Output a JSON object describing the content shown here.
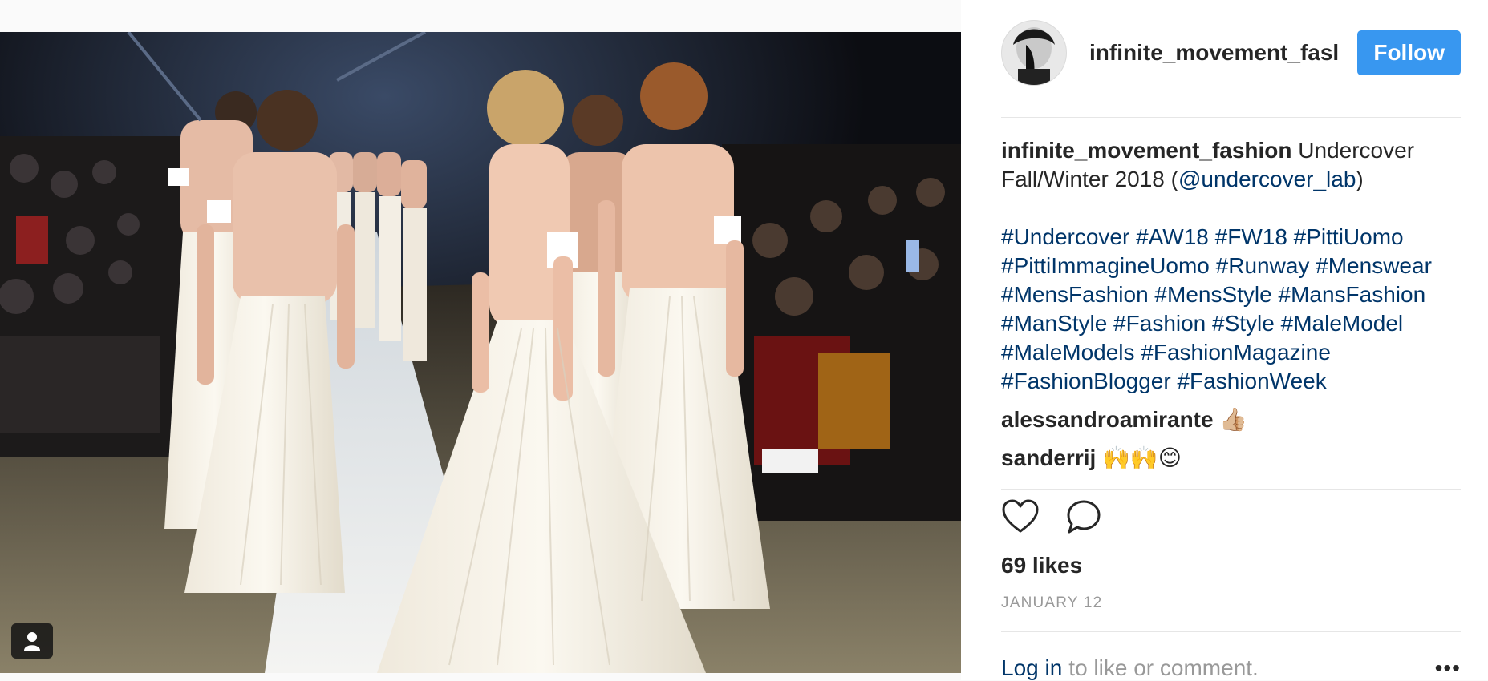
{
  "post": {
    "username": "infinite_movement_fashion",
    "header_username": "infinite_movement_fasl",
    "follow_label": "Follow",
    "caption_user": "infinite_movement_fashion",
    "caption_text_1": "Undercover Fall/Winter 2018 (",
    "caption_mention": "@undercover_lab",
    "caption_text_2": ")",
    "hashtags": "#Undercover #AW18 #FW18 #PittiUomo #PittiImmagineUomo #Runway #Menswear #MensFashion #MensStyle #MansFashion #ManStyle #Fashion #Style #MaleModel #MaleModels #FashionMagazine #FashionBlogger #FashionWeek",
    "likes": "69 likes",
    "date": "JANUARY 12"
  },
  "comments": [
    {
      "user": "alessandroamirante",
      "text": "👍🏼"
    },
    {
      "user": "sanderrij",
      "text": "🙌🙌😊"
    }
  ],
  "footer": {
    "login_link": "Log in",
    "login_text": "to like or comment.",
    "more": "•••"
  },
  "icons": {
    "like": "heart-icon",
    "comment": "comment-icon",
    "tag": "user-tag-icon",
    "more": "more-options-icon"
  },
  "colors": {
    "follow_button": "#3897f0",
    "link": "#003569",
    "muted": "#999999"
  }
}
